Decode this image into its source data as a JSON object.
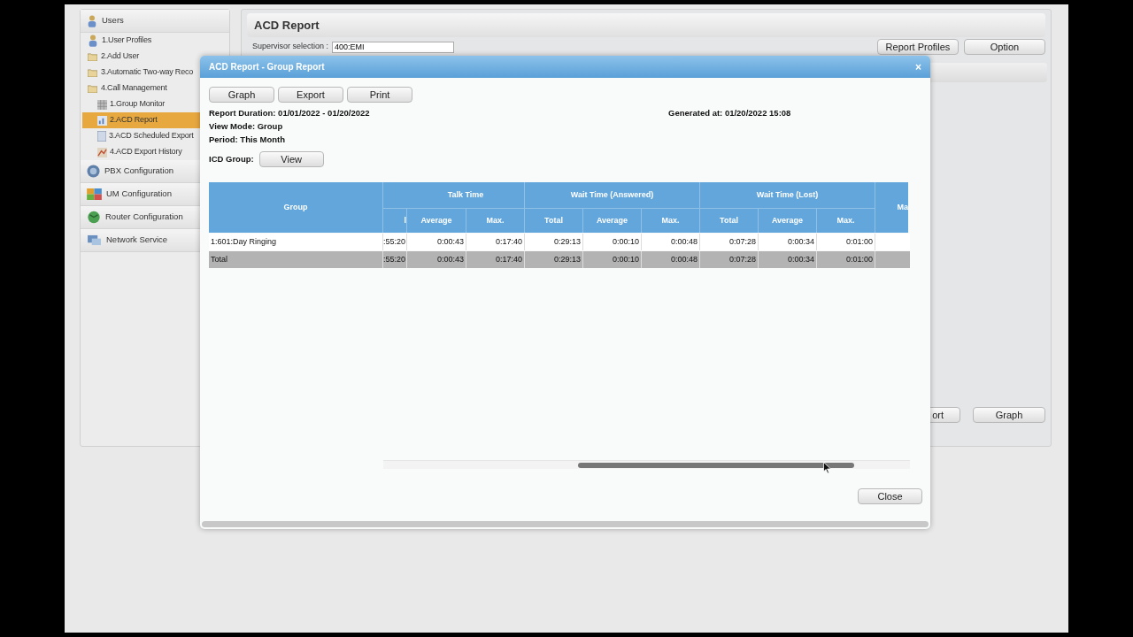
{
  "sidebar": {
    "sections": [
      {
        "label": "Users",
        "children": [
          {
            "label": "1.User Profiles",
            "selected": false
          },
          {
            "label": "2.Add User",
            "selected": false
          },
          {
            "label": "3.Automatic Two-way Reco",
            "selected": false
          },
          {
            "label": "4.Call Management",
            "selected": false,
            "children": [
              {
                "label": "1.Group Monitor",
                "selected": false
              },
              {
                "label": "2.ACD Report",
                "selected": true
              },
              {
                "label": "3.ACD Scheduled Export",
                "selected": false
              },
              {
                "label": "4.ACD Export History",
                "selected": false
              }
            ]
          }
        ]
      },
      {
        "label": "PBX Configuration"
      },
      {
        "label": "UM Configuration"
      },
      {
        "label": "Router Configuration"
      },
      {
        "label": "Network Service"
      }
    ]
  },
  "page": {
    "title": "ACD Report",
    "supervisor_label": "Supervisor selection :",
    "supervisor_value": "400:EMI",
    "top_buttons": [
      "Report Profiles",
      "Option"
    ],
    "bottom_buttons": [
      "ort",
      "Graph"
    ]
  },
  "dialog": {
    "title": "ACD Report - Group Report",
    "close_icon": "×",
    "buttons": [
      "Graph",
      "Export",
      "Print"
    ],
    "info": [
      "Report Duration: 01/01/2022 - 01/20/2022",
      "View Mode: Group",
      "Period: This Month"
    ],
    "generated": "Generated at: 01/20/2022 15:08",
    "icd_label": "ICD Group:",
    "icd_button": "View",
    "table": {
      "group_header": "Group",
      "column_groups": [
        {
          "label": "Talk Time",
          "columns": [
            "l",
            "Average",
            "Max."
          ]
        },
        {
          "label": "Wait Time (Answered)",
          "columns": [
            "Total",
            "Average",
            "Max."
          ]
        },
        {
          "label": "Wait Time (Lost)",
          "columns": [
            "Total",
            "Average",
            "Max."
          ]
        }
      ],
      "trailing_header": "Ma",
      "rows": [
        {
          "kind": "data",
          "group": "1:601:Day Ringing",
          "cells": [
            ":55:20",
            "0:00:43",
            "0:17:40",
            "0:29:13",
            "0:00:10",
            "0:00:48",
            "0:07:28",
            "0:00:34",
            "0:01:00"
          ]
        },
        {
          "kind": "total",
          "group": "Total",
          "cells": [
            ":55:20",
            "0:00:43",
            "0:17:40",
            "0:29:13",
            "0:00:10",
            "0:00:48",
            "0:07:28",
            "0:00:34",
            "0:01:00"
          ]
        }
      ]
    },
    "footer_button": "Close"
  }
}
